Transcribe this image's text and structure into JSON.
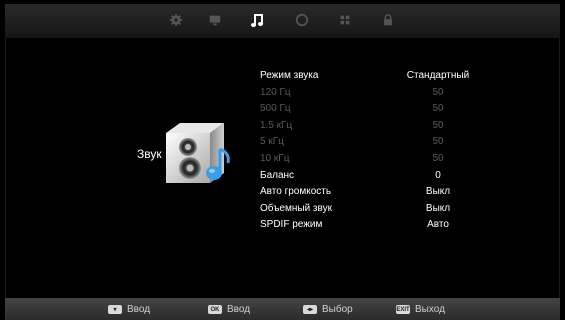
{
  "tabs": [
    {
      "icon": "gear-icon",
      "active": false
    },
    {
      "icon": "monitor-icon",
      "active": false
    },
    {
      "icon": "music-note-icon",
      "active": true
    },
    {
      "icon": "clock-icon",
      "active": false
    },
    {
      "icon": "grid-icon",
      "active": false
    },
    {
      "icon": "lock-icon",
      "active": false
    }
  ],
  "section": {
    "title": "Звук",
    "icon": "speaker-icon"
  },
  "settings": [
    {
      "label": "Режим звука",
      "value": "Стандартный",
      "enabled": true
    },
    {
      "label": "120 Гц",
      "value": "50",
      "enabled": false
    },
    {
      "label": "500 Гц",
      "value": "50",
      "enabled": false
    },
    {
      "label": "1.5 кГц",
      "value": "50",
      "enabled": false
    },
    {
      "label": "5 кГц",
      "value": "50",
      "enabled": false
    },
    {
      "label": "10 кГц",
      "value": "50",
      "enabled": false
    },
    {
      "label": "Баланс",
      "value": "0",
      "enabled": true
    },
    {
      "label": "Авто громкость",
      "value": "Выкл",
      "enabled": true
    },
    {
      "label": "Объемный звук",
      "value": "Выкл",
      "enabled": true
    },
    {
      "label": "SPDIF режим",
      "value": "Авто",
      "enabled": true
    }
  ],
  "hints": [
    {
      "key": "",
      "icon": "down-arrow-key-icon",
      "label": "Ввод"
    },
    {
      "key": "OK",
      "icon": "ok-key-icon",
      "label": "Ввод"
    },
    {
      "key": "◂▸",
      "icon": "left-right-key-icon",
      "label": "Выбор"
    },
    {
      "key": "EXIT",
      "icon": "exit-key-icon",
      "label": "Выход"
    }
  ],
  "colors": {
    "active": "#ffffff",
    "disabled": "#5a5a5a",
    "tab_icon": "#555555"
  }
}
